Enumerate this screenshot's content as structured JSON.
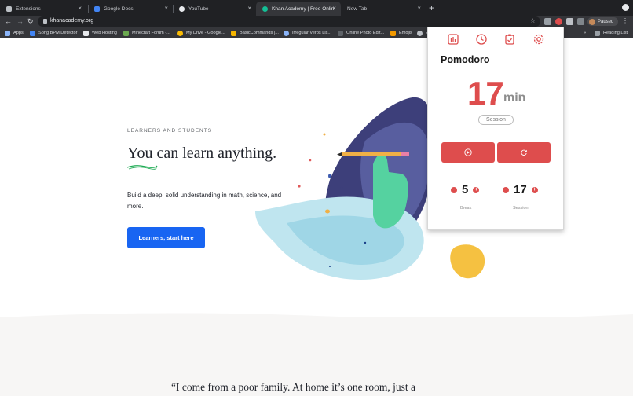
{
  "tabs": [
    {
      "label": "Extensions",
      "close": "×"
    },
    {
      "label": "Google Docs",
      "close": "×"
    },
    {
      "label": "YouTube",
      "close": "×"
    },
    {
      "label": "Khan Academy | Free Online C",
      "close": "×"
    },
    {
      "label": "New Tab",
      "close": "×"
    }
  ],
  "new_tab": "+",
  "toolbar": {
    "back": "←",
    "forward": "→",
    "reload": "↻",
    "url": "khanacademy.org",
    "star": "☆",
    "profile_status": "Paused",
    "menu": "⋮"
  },
  "bookmarks": [
    {
      "label": "Apps"
    },
    {
      "label": "Song BPM Detector"
    },
    {
      "label": "Web Hosting"
    },
    {
      "label": "Minecraft Forum -..."
    },
    {
      "label": "My Drive - Google..."
    },
    {
      "label": "BasicCommands |..."
    },
    {
      "label": "Irregular Verbs Lis..."
    },
    {
      "label": "Online Photo Edit..."
    },
    {
      "label": "Emojis"
    },
    {
      "label": "E"
    }
  ],
  "bookmarks_more": "»",
  "reading_list": "Reading List",
  "page": {
    "eyebrow": "LEARNERS AND STUDENTS",
    "headline": "You can learn anything.",
    "subtext": "Build a deep, solid understanding in math, science, and more.",
    "cta": "Learners, start here",
    "quote": "“I come from a poor family. At home it’s one room, just a"
  },
  "popup": {
    "title": "Pomodoro",
    "time_value": "17",
    "time_unit": "min",
    "mode": "Session",
    "break_value": "5",
    "break_label": "Break",
    "session_value": "17",
    "session_label": "Session",
    "minus": "−",
    "plus": "+"
  },
  "colors": {
    "accent": "#de4d4d",
    "cta": "#1865f2",
    "chrome_dark": "#202124"
  }
}
